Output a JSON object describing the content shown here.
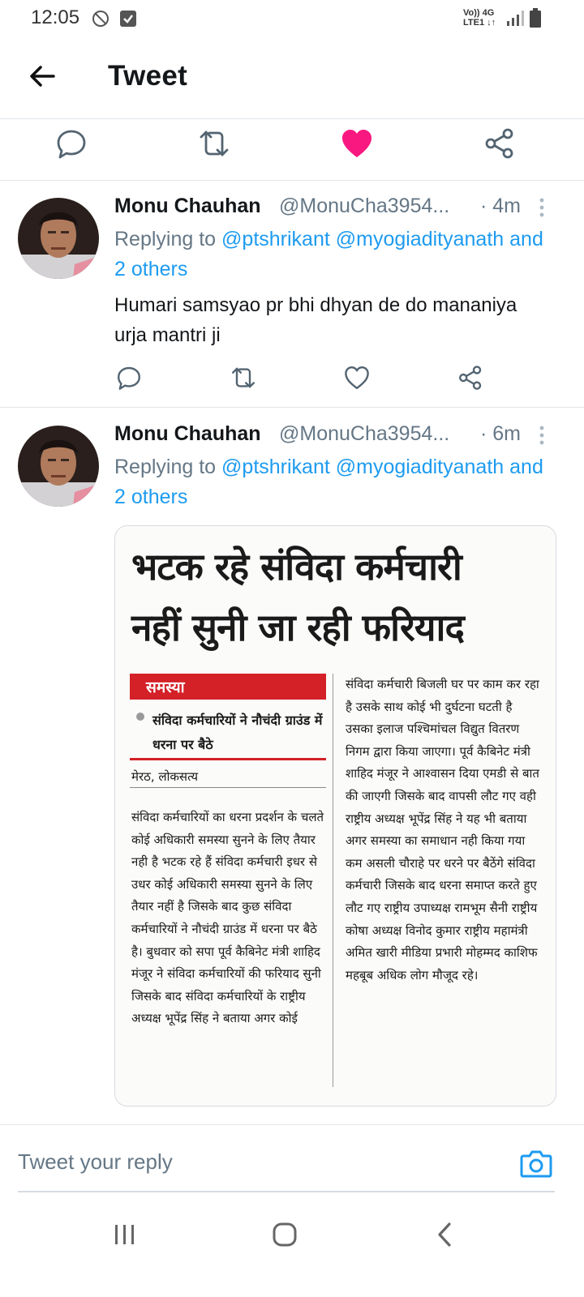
{
  "status_bar": {
    "time": "12:05",
    "network_top": "Vo)) 4G",
    "network_bottom": "LTE1 ↓↑"
  },
  "header": {
    "title": "Tweet"
  },
  "tweets": [
    {
      "name": "Monu Chauhan",
      "handle": "@MonuCha3954...",
      "time": "· 4m",
      "replying_prefix": "Replying to",
      "mentions": "@ptshrikant @myogiadityanath",
      "others": "and 2 others",
      "text": "Humari samsyao pr bhi dhyan de do mananiya urja mantri ji"
    },
    {
      "name": "Monu Chauhan",
      "handle": "@MonuCha3954...",
      "time": "· 6m",
      "replying_prefix": "Replying to",
      "mentions": "@ptshrikant @myogiadityanath",
      "others": "and 2 others"
    }
  ],
  "newspaper": {
    "headline1": "भटक रहे संविदा कर्मचारी",
    "headline2": "नहीं सुनी जा रही फरियाद",
    "tag": "समस्या",
    "subhead": "संविदा कर्मचारियों ने नौचंदी ग्राउंड में धरना पर बैठे",
    "dateline": "मेरठ, लोकसत्य",
    "col_left": "संविदा कर्मचारियों का धरना प्रदर्शन के चलते कोई अधिकारी समस्या सुनने के लिए तैयार नही है भटक रहे हैं संविदा कर्मचारी इधर से उधर कोई अधिकारी समस्या सुनने के लिए तैयार नहीं है जिसके बाद कुछ संविदा कर्मचारियों ने नौचंदी ग्राउंड में धरना पर बैठे है। बुधवार को सपा पूर्व कैबिनेट मंत्री शाहिद मंजूर ने संविदा कर्मचारियों की फरियाद सुनी जिसके बाद संविदा कर्मचारियों के राष्ट्रीय अध्यक्ष भूपेंद्र सिंह ने बताया अगर कोई",
    "col_right": "संविदा कर्मचारी बिजली घर पर काम कर रहा है उसके साथ कोई भी दुर्घटना घटती है उसका इलाज पश्चिमांचल विद्युत वितरण निगम द्वारा किया जाएगा। पूर्व कैबिनेट मंत्री शाहिद मंजूर ने आश्वासन दिया एमडी से बात की जाएगी जिसके बाद वापसी लौट गए वही राष्ट्रीय अध्यक्ष भूपेंद्र सिंह ने यह भी बताया अगर समस्या का समाधान नही किया गया कम असली चौराहे पर धरने पर बैठेंगे संविदा कर्मचारी जिसके बाद धरना समाप्त करते हुए लौट गए राष्ट्रीय उपाध्यक्ष रामभूम सैनी राष्ट्रीय कोषा अध्यक्ष विनोद कुमार राष्ट्रीय महामंत्री अमित खारी मीडिया प्रभारी मोहम्मद काशिफ महबूब अधिक लोग मौजूद रहे।"
  },
  "reply": {
    "placeholder": "Tweet your reply"
  },
  "colors": {
    "accent": "#1d9bf0",
    "like": "#f91880",
    "text": "#14171a",
    "muted": "#657786",
    "news_red": "#d42027"
  }
}
